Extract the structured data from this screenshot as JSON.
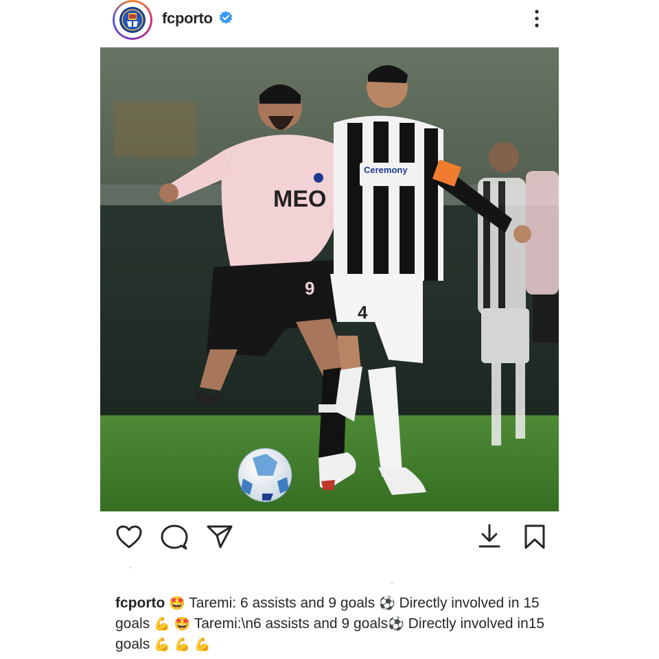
{
  "post": {
    "username": "fcporto",
    "verified_icon": "verified-badge-icon",
    "more_icon": "more-options-icon",
    "avatar_icon": "fc-porto-crest-icon"
  },
  "image": {
    "alt": "",
    "jersey_text": "MEO",
    "opponent_sponsor": "Ceremony",
    "number_left": "9",
    "number_right": "4"
  },
  "actions": {
    "like_icon": "heart-icon",
    "comment_icon": "comment-icon",
    "share_icon": "send-icon",
    "download_icon": "download-icon",
    "save_icon": "bookmark-icon"
  },
  "caption": {
    "username": "fcporto",
    "part1": " Taremi: 6 assists and 9 goals ",
    "part2": " Directly involved in 15 goals ",
    "part3": " Taremi:\\n6 assists and 9 goals",
    "part4": " Directly involved in15 goals ",
    "emoji_star": "🤩",
    "emoji_ball": "⚽",
    "emoji_flex": "💪"
  },
  "colors": {
    "verified": "#3897f0",
    "text": "#262626",
    "pitch": "#3f7a2c",
    "porto_kit": "#f3d2d6"
  }
}
